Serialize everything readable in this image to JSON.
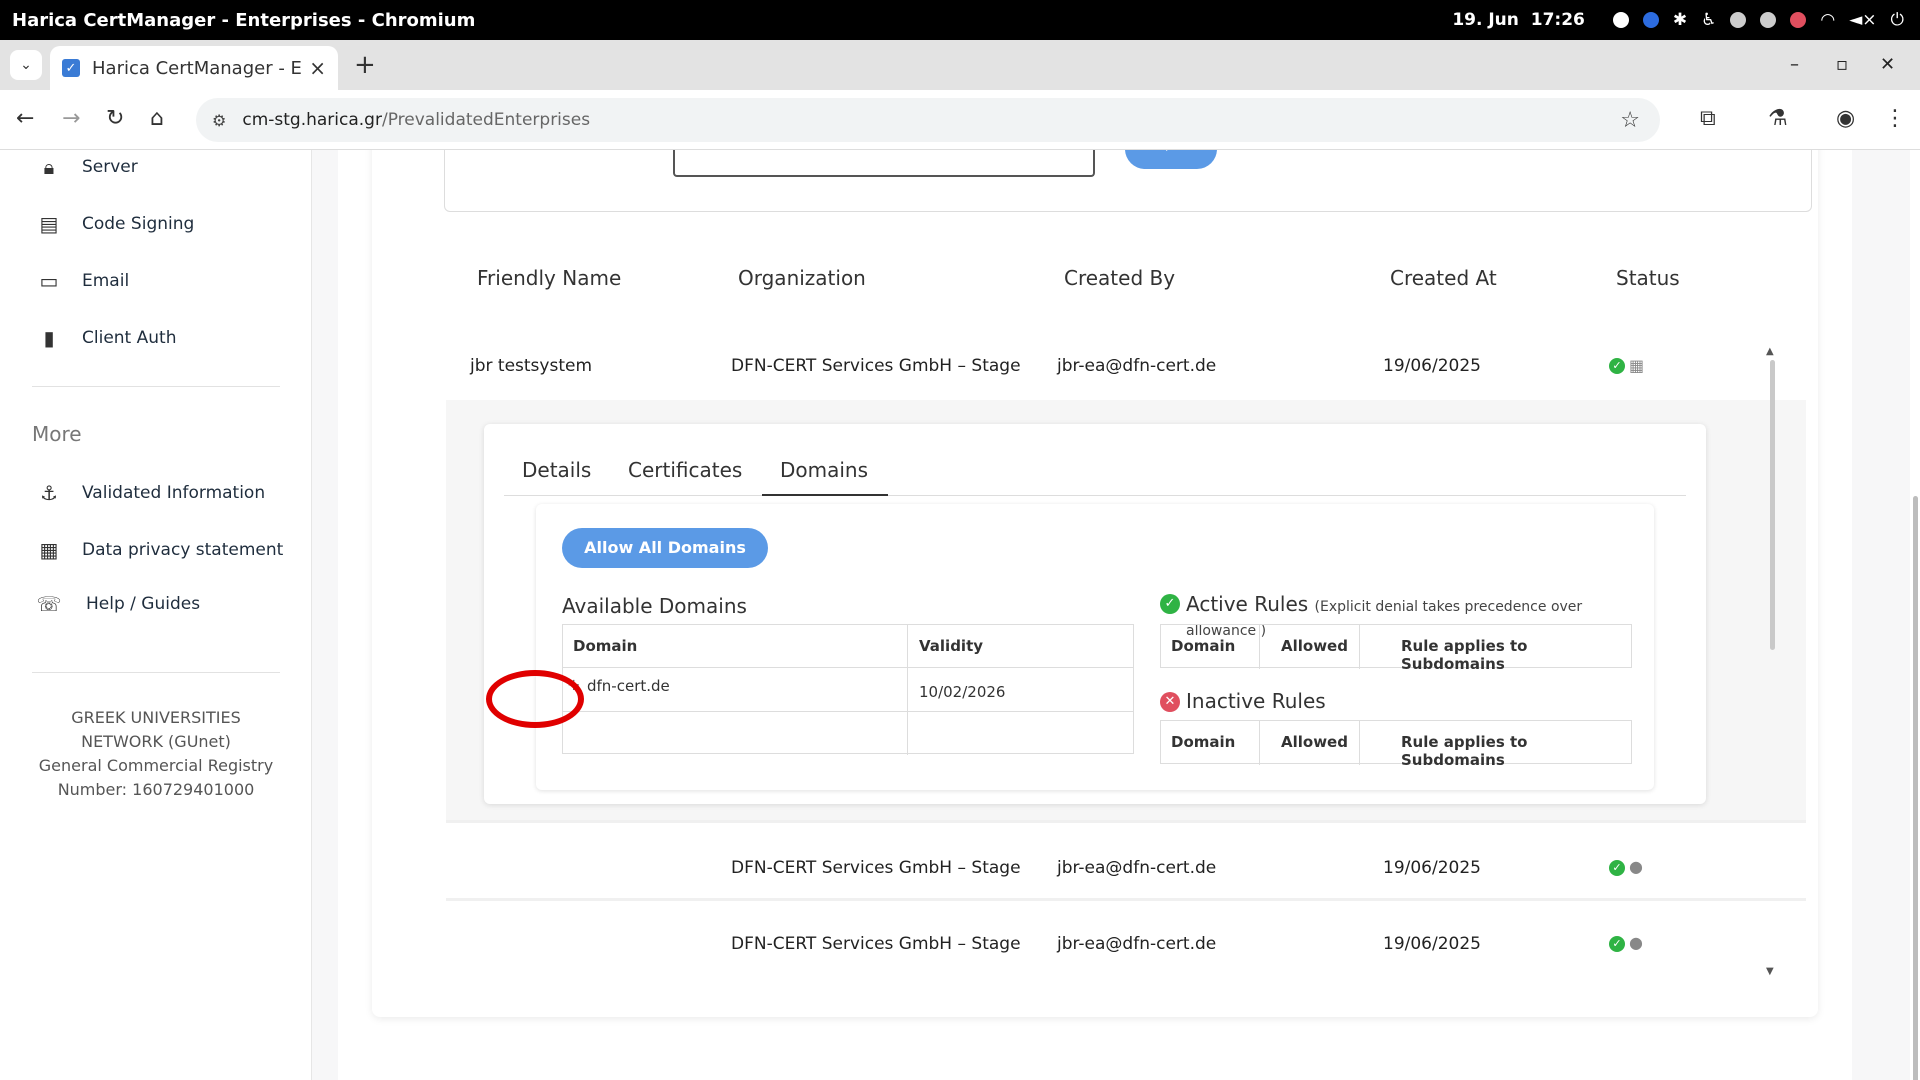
{
  "os": {
    "window_title": "Harica CertManager - Enterprises - Chromium",
    "date": "19. Jun",
    "time": "17:26"
  },
  "browser": {
    "tab_title": "Harica CertManager - E",
    "url_host": "cm-stg.harica.gr",
    "url_path": "/PrevalidatedEnterprises"
  },
  "sidebar": {
    "items": [
      {
        "label": "Server",
        "icon": "lock-icon"
      },
      {
        "label": "Code Signing",
        "icon": "code-icon"
      },
      {
        "label": "Email",
        "icon": "email-icon"
      },
      {
        "label": "Client Auth",
        "icon": "id-badge-icon"
      }
    ],
    "more_heading": "More",
    "more_items": [
      {
        "label": "Validated Information",
        "icon": "anchor-icon"
      },
      {
        "label": "Data privacy statement",
        "icon": "id-card-icon"
      },
      {
        "label": "Help / Guides",
        "icon": "support-icon"
      }
    ],
    "footer": [
      "GREEK UNIVERSITIES",
      "NETWORK (GUnet)",
      "General Commercial Registry",
      "Number: 160729401000"
    ]
  },
  "table": {
    "headers": [
      "Friendly Name",
      "Organization",
      "Created By",
      "Created At",
      "Status"
    ],
    "rows": [
      {
        "friendly_name": "jbr testsystem",
        "organization": "DFN-CERT Services GmbH – Stage",
        "created_by": "jbr-ea@dfn-cert.de",
        "created_at": "19/06/2025"
      },
      {
        "friendly_name": "",
        "organization": "DFN-CERT Services GmbH – Stage",
        "created_by": "jbr-ea@dfn-cert.de",
        "created_at": "19/06/2025"
      },
      {
        "friendly_name": "",
        "organization": "DFN-CERT Services GmbH – Stage",
        "created_by": "jbr-ea@dfn-cert.de",
        "created_at": "19/06/2025"
      }
    ]
  },
  "panel": {
    "tabs": [
      "Details",
      "Certificates",
      "Domains"
    ],
    "active_tab": "Domains",
    "allow_all_label": "Allow All Domains",
    "available": {
      "title": "Available Domains",
      "col_domain": "Domain",
      "col_validity": "Validity",
      "rows": [
        {
          "domain": "dfn-cert.de",
          "validity": "10/02/2026"
        }
      ]
    },
    "active_rules": {
      "title": "Active Rules",
      "note": "(Explicit denial takes precedence over allowance )",
      "cols": [
        "Domain",
        "Allowed",
        "Rule applies to Subdomains"
      ]
    },
    "inactive_rules": {
      "title": "Inactive Rules",
      "cols": [
        "Domain",
        "Allowed",
        "Rule applies to Subdomains"
      ]
    }
  },
  "colors": {
    "accent": "#5b9ae6",
    "success": "#2fb344",
    "danger": "#e04f5f",
    "annotation": "#e00000"
  }
}
